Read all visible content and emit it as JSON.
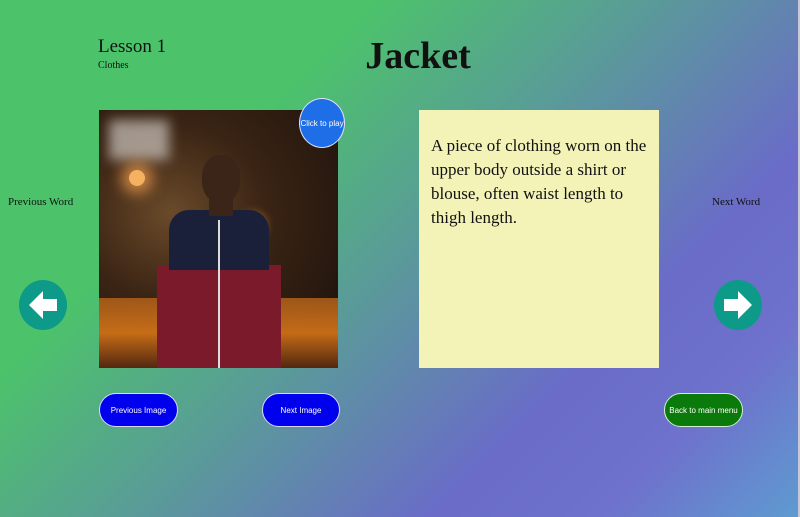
{
  "header": {
    "lesson": "Lesson 1",
    "category": "Clothes",
    "word": "Jacket"
  },
  "nav": {
    "previous_word_label": "Previous Word",
    "next_word_label": "Next Word",
    "prev_arrow_icon": "arrow-left-icon",
    "next_arrow_icon": "arrow-right-icon"
  },
  "image": {
    "play_label": "Click to play"
  },
  "definition": {
    "text": "A piece of clothing worn on the upper body outside a shirt or blouse, often waist length to thigh length."
  },
  "buttons": {
    "previous_image": "Previous Image",
    "next_image": "Next Image",
    "back_to_menu": "Back to main menu"
  },
  "colors": {
    "accent_blue": "#0000ee",
    "play_blue": "#1e6ee8",
    "menu_green": "#0a7a0a",
    "arrow_teal": "#0e9a88",
    "definition_bg": "#f3f3b8"
  }
}
